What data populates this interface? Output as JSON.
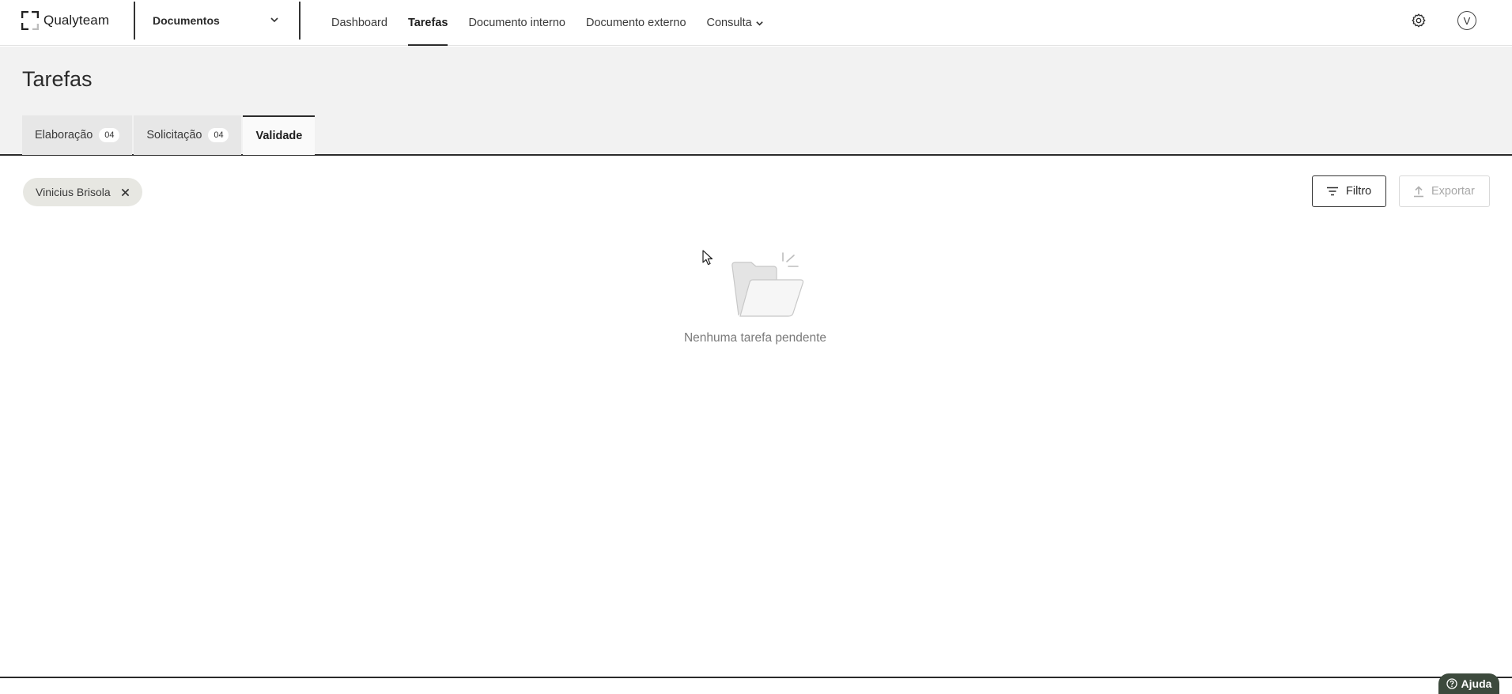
{
  "brand": {
    "name": "Qualyteam",
    "logo_icon": "qualyteam-logo-icon"
  },
  "module_selector": {
    "label": "Documentos",
    "icon": "chevron-down-icon"
  },
  "nav": {
    "items": [
      {
        "label": "Dashboard"
      },
      {
        "label": "Tarefas"
      },
      {
        "label": "Documento interno"
      },
      {
        "label": "Documento externo"
      },
      {
        "label": "Consulta"
      }
    ]
  },
  "top_actions": {
    "settings_icon": "gear-icon",
    "avatar_initial": "V"
  },
  "page": {
    "title": "Tarefas"
  },
  "tabs": [
    {
      "label": "Elaboração",
      "count": "04"
    },
    {
      "label": "Solicitação",
      "count": "04"
    },
    {
      "label": "Validade"
    }
  ],
  "filter_chip": {
    "label": "Vinicius Brisola",
    "close_icon": "close-icon"
  },
  "toolbar": {
    "filter_label": "Filtro",
    "export_label": "Exportar"
  },
  "empty_state": {
    "text": "Nenhuma tarefa pendente",
    "icon": "empty-folder-icon"
  },
  "help": {
    "label": "Ajuda",
    "icon": "question-circle-icon"
  },
  "colors": {
    "accent": "#2b2b2b",
    "header_band": "#f2f2f2",
    "chip_bg": "#e7e7e2",
    "help_bg": "#3d4a3d"
  }
}
